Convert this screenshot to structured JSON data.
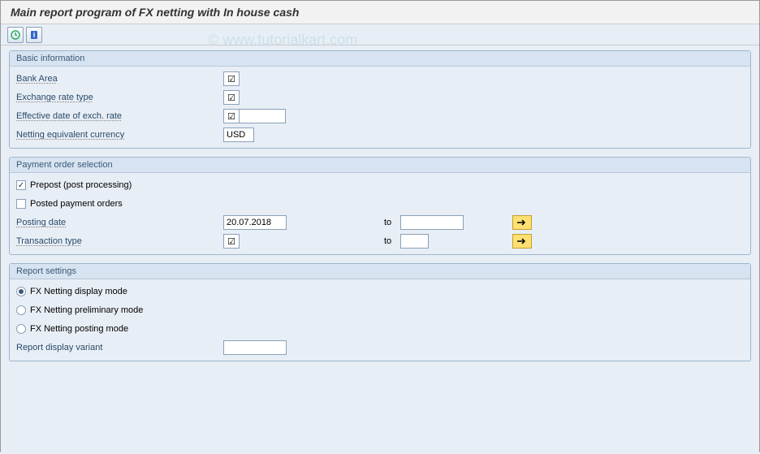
{
  "title": "Main report program of FX netting with In house cash",
  "watermark": "© www.tutorialkart.com",
  "groups": {
    "basic": {
      "title": "Basic information",
      "rows": {
        "bank_area": {
          "label": "Bank Area",
          "value": ""
        },
        "exch_rate_type": {
          "label": "Exchange rate type",
          "value": ""
        },
        "eff_date": {
          "label": "Effective date of exch. rate",
          "value": ""
        },
        "netting_curr": {
          "label": "Netting equivalent currency",
          "value": "USD"
        }
      }
    },
    "payment": {
      "title": "Payment order selection",
      "prepost": {
        "label": "Prepost (post processing)",
        "checked": true
      },
      "posted": {
        "label": "Posted payment orders",
        "checked": false
      },
      "posting_date": {
        "label": "Posting date",
        "from": "20.07.2018",
        "to_label": "to",
        "to": ""
      },
      "trans_type": {
        "label": "Transaction type",
        "from": "",
        "to_label": "to",
        "to": ""
      }
    },
    "report": {
      "title": "Report settings",
      "r1": {
        "label": "FX Netting display mode"
      },
      "r2": {
        "label": "FX Netting preliminary mode"
      },
      "r3": {
        "label": "FX Netting posting mode"
      },
      "variant": {
        "label": "Report display variant",
        "value": ""
      },
      "selected": "r1"
    }
  }
}
